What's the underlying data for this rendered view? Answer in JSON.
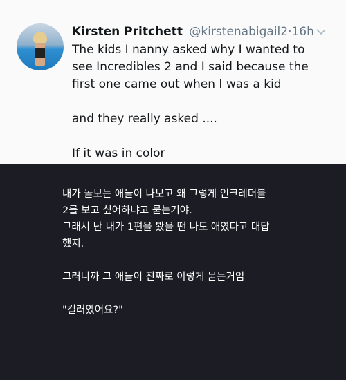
{
  "tweet": {
    "display_name": "Kirsten Pritchett",
    "handle": "@kirstenabigail2",
    "separator": "·",
    "time": "16h",
    "lines": [
      "The kids I nanny asked why I wanted to",
      "see Incredibles 2 and I said because the",
      "first one came out when I was a kid",
      "and they really asked ....",
      "If it was in color"
    ]
  },
  "translation": {
    "lines": [
      "내가 돌보는 애들이 나보고 왜 그렇게 인크레더블",
      "2를 보고 싶어하냐고 묻는거야.",
      "그래서 난 내가 1편을 봤을 땐 나도 애였다고 대답",
      "했지.",
      "그러니까 그 애들이 진짜로 이렇게 묻는거임",
      "\"컬러였어요?\""
    ]
  },
  "icons": {
    "avatar": "profile-photo",
    "menu": "chevron-down-icon"
  },
  "colors": {
    "tweet_bg": "#fafafa",
    "page_bg": "#1c1c25",
    "muted": "#657786"
  }
}
